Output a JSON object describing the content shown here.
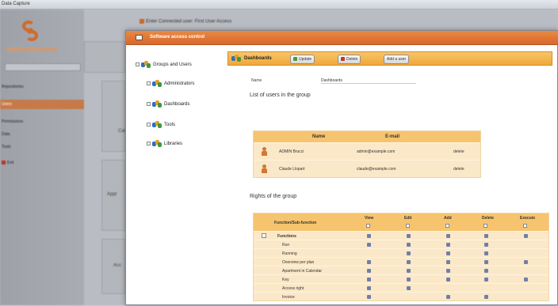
{
  "topbar": {
    "title": "Data Capture"
  },
  "background": {
    "header": "Enter   Connected user: First User Access",
    "menu": [
      {
        "label": "Repositories",
        "selected": false
      },
      {
        "label": "Users",
        "selected": true
      },
      {
        "label": "Permissions",
        "selected": false
      },
      {
        "label": "Data",
        "selected": false
      },
      {
        "label": "Tools",
        "selected": false
      },
      {
        "label": "Exit",
        "selected": false,
        "dot": true
      }
    ],
    "tiles": [
      "Cal",
      "Appr",
      "Acc"
    ]
  },
  "dialog": {
    "title": "Software access control",
    "tree": {
      "root": "Groups and Users",
      "items": [
        "Administrators",
        "Dashboards",
        "Tools",
        "Libraries"
      ]
    },
    "panel": {
      "title": "Dashboards",
      "buttons": {
        "update": "Update",
        "delete": "Delete",
        "add_user": "Add a user"
      },
      "name_label": "Name",
      "name_value": "Dashboards",
      "users_section": "List of users in the group",
      "users_table": {
        "columns": [
          "Name",
          "E-mail"
        ],
        "rows": [
          {
            "name": "ADMIN Brucci",
            "email": "admin@example.com",
            "extra": "delete"
          },
          {
            "name": "Claude Llopart",
            "email": "claude@example.com",
            "extra": "delete"
          }
        ]
      },
      "rights_section": "Rights of the group",
      "rights_table": {
        "columns": [
          "Function/Sub-function",
          "View",
          "Edit",
          "Add",
          "Delete",
          "Execute"
        ],
        "rows": [
          {
            "label": "Functions",
            "group": true,
            "checks": [
              true,
              true,
              true,
              true,
              true
            ]
          },
          {
            "label": "Run",
            "group": false,
            "checks": [
              true,
              true,
              true,
              true,
              false
            ]
          },
          {
            "label": "Running",
            "group": false,
            "checks": [
              false,
              true,
              true,
              true,
              false
            ]
          },
          {
            "label": "Overview per plan",
            "group": false,
            "checks": [
              true,
              true,
              true,
              true,
              true
            ]
          },
          {
            "label": "Apartment in Calendar",
            "group": false,
            "checks": [
              true,
              true,
              true,
              true,
              false
            ]
          },
          {
            "label": "Key",
            "group": false,
            "checks": [
              true,
              true,
              true,
              true,
              true
            ]
          },
          {
            "label": "Access right",
            "group": false,
            "checks": [
              true,
              true,
              false,
              false,
              false
            ]
          },
          {
            "label": "Invoice",
            "group": false,
            "checks": [
              true,
              false,
              true,
              true,
              false
            ]
          }
        ]
      }
    }
  }
}
